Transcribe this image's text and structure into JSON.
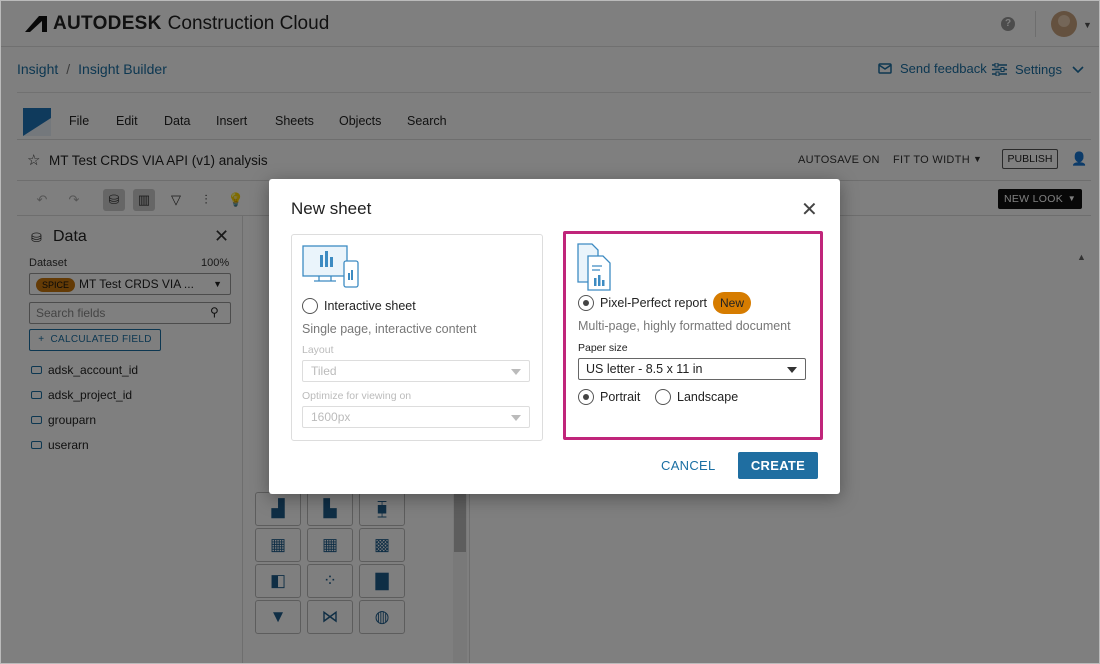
{
  "header": {
    "brand_bold": "AUTODESK",
    "brand_rest": "Construction Cloud",
    "help": "?"
  },
  "breadcrumb": {
    "items": [
      "Insight",
      "Insight Builder"
    ],
    "separator": "/"
  },
  "topnav": {
    "feedback": "Send feedback",
    "settings": "Settings"
  },
  "menubar": {
    "items": [
      "File",
      "Edit",
      "Data",
      "Insert",
      "Sheets",
      "Objects",
      "Search"
    ]
  },
  "analysis": {
    "title": "MT Test CRDS VIA API (v1) analysis",
    "autosave": "AUTOSAVE ON",
    "fit": "FIT TO WIDTH",
    "publish": "PUBLISH",
    "new_look": "NEW LOOK"
  },
  "data_panel": {
    "title": "Data",
    "dataset_label": "Dataset",
    "dataset_pct": "100%",
    "spice": "SPICE",
    "dataset_name": "MT Test CRDS VIA ...",
    "search_placeholder": "Search fields",
    "calc_field": "CALCULATED FIELD",
    "fields": [
      "adsk_account_id",
      "adsk_project_id",
      "grouparn",
      "userarn"
    ]
  },
  "dialog": {
    "title": "New sheet",
    "interactive": {
      "label": "Interactive sheet",
      "desc": "Single page, interactive content",
      "layout_label": "Layout",
      "layout_value": "Tiled",
      "optimize_label": "Optimize for viewing on",
      "optimize_value": "1600px"
    },
    "pixel": {
      "label": "Pixel-Perfect report",
      "badge": "New",
      "desc": "Multi-page, highly formatted document",
      "paper_label": "Paper size",
      "paper_value": "US letter - 8.5 x 11 in",
      "portrait": "Portrait",
      "landscape": "Landscape"
    },
    "cancel": "CANCEL",
    "create": "CREATE"
  },
  "colors": {
    "accent": "#1a6fa3",
    "highlight": "#c0257a",
    "badge": "#d67c00",
    "primary_button": "#1f6ea1"
  }
}
